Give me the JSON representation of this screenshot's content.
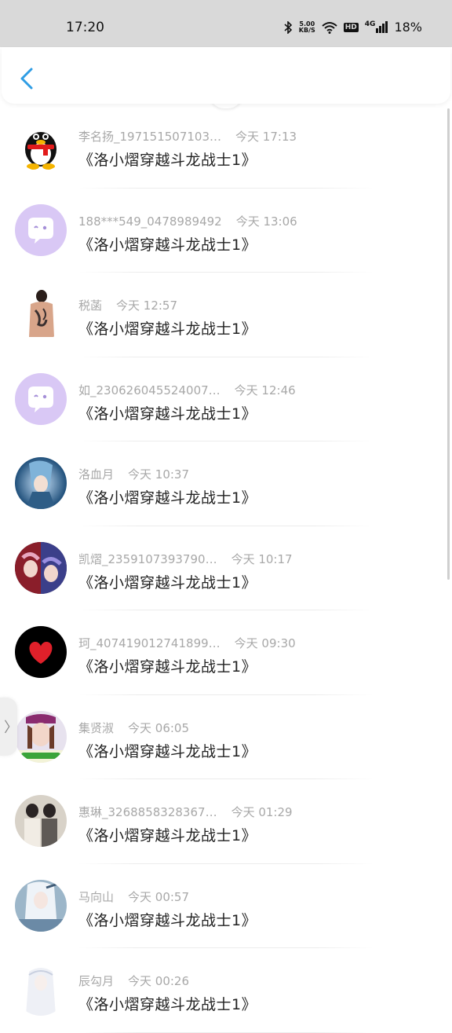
{
  "status": {
    "time": "17:20",
    "net_speed_top": "5.00",
    "net_speed_bottom": "KB/S",
    "hd": "HD",
    "signal": "4G",
    "battery": "18%"
  },
  "header": {
    "back_icon": "chevron-left-icon"
  },
  "messages": [
    {
      "name": "李名扬_197151507103…",
      "time": "今天 17:13",
      "text": "《洛小熠穿越斗龙战士1》",
      "avatar": "qq-penguin"
    },
    {
      "name": "188***549_0478989492",
      "time": "今天 13:06",
      "text": "《洛小熠穿越斗龙战士1》",
      "avatar": "chat-bubble"
    },
    {
      "name": "税菡",
      "time": "今天 12:57",
      "text": "《洛小熠穿越斗龙战士1》",
      "avatar": "photo-back"
    },
    {
      "name": "如_230626045524007…",
      "time": "今天 12:46",
      "text": "《洛小熠穿越斗龙战士1》",
      "avatar": "chat-bubble"
    },
    {
      "name": "洛血月",
      "time": "今天 10:37",
      "text": "《洛小熠穿越斗龙战士1》",
      "avatar": "anime-blue"
    },
    {
      "name": "凯熠_2359107393790…",
      "time": "今天 10:17",
      "text": "《洛小熠穿越斗龙战士1》",
      "avatar": "anime-red"
    },
    {
      "name": "珂_407419012741899…",
      "time": "今天 09:30",
      "text": "《洛小熠穿越斗龙战士1》",
      "avatar": "heart"
    },
    {
      "name": "集贤淑",
      "time": "今天 06:05",
      "text": "《洛小熠穿越斗龙战士1》",
      "avatar": "photo-girl"
    },
    {
      "name": "惠琳_3268858328367…",
      "time": "今天 01:29",
      "text": "《洛小熠穿越斗龙战士1》",
      "avatar": "photo-couple"
    },
    {
      "name": "马向山",
      "time": "今天 00:57",
      "text": "《洛小熠穿越斗龙战士1》",
      "avatar": "anime-white"
    },
    {
      "name": "辰勾月",
      "time": "今天 00:26",
      "text": "《洛小熠穿越斗龙战士1》",
      "avatar": "anime-light"
    }
  ],
  "side_handle": "〉"
}
